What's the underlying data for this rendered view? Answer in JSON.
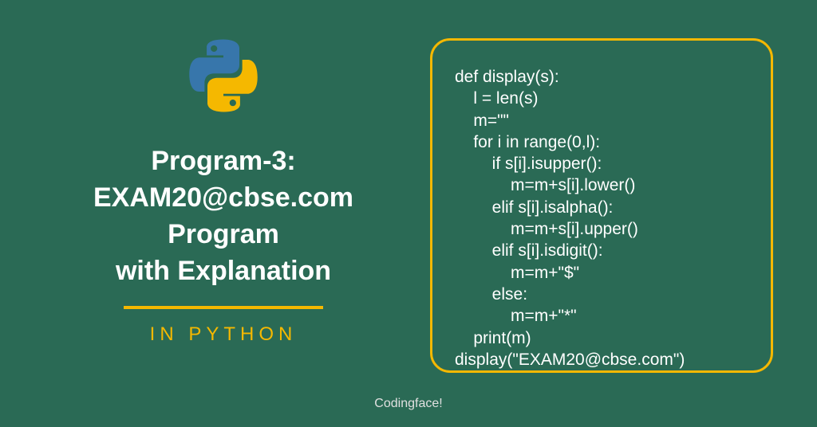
{
  "title": {
    "line1": "Program-3:",
    "line2": "EXAM20@cbse.com",
    "line3": "Program",
    "line4": "with Explanation"
  },
  "subtitle": "IN PYTHON",
  "code": {
    "line1": "def display(s):",
    "line2": "    l = len(s)",
    "line3": "    m=\"\"",
    "line4": "    for i in range(0,l):",
    "line5": "        if s[i].isupper():",
    "line6": "            m=m+s[i].lower()",
    "line7": "        elif s[i].isalpha():",
    "line8": "            m=m+s[i].upper()",
    "line9": "        elif s[i].isdigit():",
    "line10": "            m=m+\"$\"",
    "line11": "        else:",
    "line12": "            m=m+\"*\"",
    "line13": "    print(m)",
    "line14": "display(\"EXAM20@cbse.com\")"
  },
  "footer": "Codingface!"
}
